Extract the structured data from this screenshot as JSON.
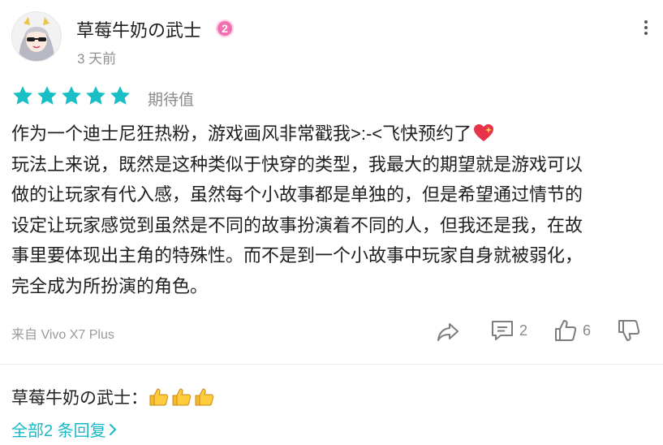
{
  "review": {
    "author": {
      "name": "草莓牛奶の武士",
      "level_badge": "2",
      "avatar": "anime-girl-avatar"
    },
    "time": "3 天前",
    "rating": {
      "stars": 5,
      "max": 5,
      "label": "期待值",
      "star_color": "#19bfc4"
    },
    "content_lines": [
      "作为一个迪士尼狂热粉，游戏画风非常戳我>:-<飞快预约了",
      "玩法上来说，既然是这种类似于快穿的类型，我最大的期望就是游戏可以",
      "做的让玩家有代入感，虽然每个小故事都是单独的，但是希望通过情节的",
      "设定让玩家感觉到虽然是不同的故事扮演着不同的人，但我还是我，在故",
      "事里要体现出主角的特殊性。而不是到一个小故事中玩家自身就被弱化，",
      "完全成为所扮演的角色。"
    ],
    "device": "来自 Vivo X7 Plus",
    "actions": {
      "share_icon": "share-icon",
      "comment_count": "2",
      "like_count": "6",
      "dislike_icon": "thumbs-down-icon"
    }
  },
  "replies": {
    "first_reply_author": "草莓牛奶の武士",
    "first_reply_separator": "：",
    "first_reply_emojis": [
      "thumbs-up",
      "thumbs-up",
      "thumbs-up"
    ],
    "view_all_label": "全部2 条回复"
  },
  "colors": {
    "accent": "#17b9c6",
    "muted": "#8f8f8f",
    "badge": "#f06fb1"
  }
}
